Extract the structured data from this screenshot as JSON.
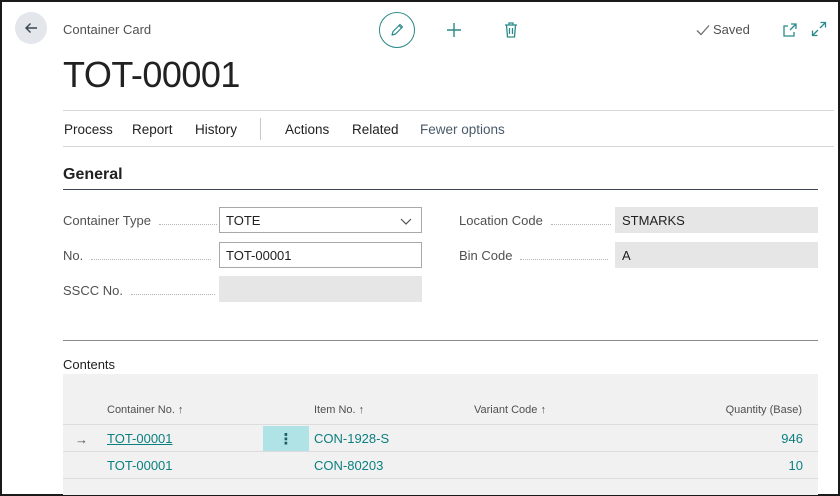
{
  "header": {
    "caption": "Container Card",
    "title": "TOT-00001",
    "saved_label": "Saved",
    "icons": [
      "back-arrow-icon",
      "edit-pencil-icon",
      "plus-icon",
      "trash-icon",
      "check-icon",
      "open-new-window-icon",
      "expand-icon"
    ]
  },
  "actions": {
    "process": "Process",
    "report": "Report",
    "history": "History",
    "actions": "Actions",
    "related": "Related",
    "fewer_options": "Fewer options"
  },
  "general": {
    "title": "General",
    "container_type": {
      "label": "Container Type",
      "value": "TOTE"
    },
    "no": {
      "label": "No.",
      "value": "TOT-00001"
    },
    "sscc_no": {
      "label": "SSCC No.",
      "value": ""
    },
    "location_code": {
      "label": "Location Code",
      "value": "STMARKS"
    },
    "bin_code": {
      "label": "Bin Code",
      "value": "A"
    }
  },
  "contents": {
    "title": "Contents",
    "columns": {
      "container_no": "Container No. ↑",
      "item_no": "Item No. ↑",
      "variant_code": "Variant Code ↑",
      "quantity_base": "Quantity (Base)"
    },
    "rows": [
      {
        "container_no": "TOT-00001",
        "item_no": "CON-1928-S",
        "variant_code": "",
        "quantity": "946"
      },
      {
        "container_no": "TOT-00001",
        "item_no": "CON-80203",
        "variant_code": "",
        "quantity": "10"
      }
    ],
    "row_menu_glyph": "⋮",
    "row_arrow_glyph": "→"
  },
  "colors": {
    "accent": "#0b7f7f",
    "selected_cell": "#b0e3e6",
    "grid_bg": "#f1f1f1",
    "readonly_bg": "#e6e6e6"
  }
}
